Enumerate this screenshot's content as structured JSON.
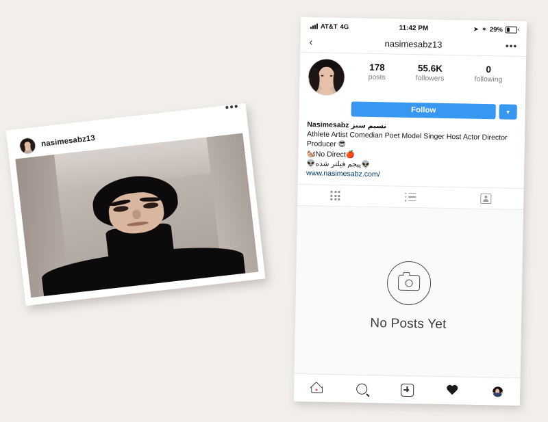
{
  "background_color": "#f2efeb",
  "accent_color": "#3897f0",
  "post_card": {
    "username": "nasimesabz13",
    "menu_icon": "more-options-icon",
    "menu_label": "•••",
    "photo_description": "Person wearing a black balaclava in front of a light wall"
  },
  "phone": {
    "status_bar": {
      "signal_icon": "cellular-signal-icon",
      "carrier": "AT&T",
      "network": "4G",
      "time": "11:42 PM",
      "location_icon": "location-arrow-icon",
      "location_glyph": "➤",
      "bluetooth_icon": "bluetooth-icon",
      "bluetooth_glyph": "✶",
      "battery_percent": "29%",
      "battery_icon": "battery-icon"
    },
    "nav_bar": {
      "back_icon": "chevron-left-icon",
      "back_glyph": "‹",
      "title": "nasimesabz13",
      "more_icon": "more-options-icon",
      "more_glyph": "•••"
    },
    "profile": {
      "avatar": "profile-avatar",
      "stats": [
        {
          "number": "178",
          "label": "posts"
        },
        {
          "number": "55.6K",
          "label": "followers"
        },
        {
          "number": "0",
          "label": "following"
        }
      ],
      "follow_label": "Follow",
      "follow_dropdown_icon": "chevron-down-icon",
      "follow_dropdown_glyph": "▼",
      "bio": {
        "name": "Nasimesabz نسیم سبز",
        "line1": "Athlete Artist Comedian Poet Model Singer Host Actor Director Producer 😎",
        "line2": "🐿️No Direct🍎",
        "line3": "👽پیجم فیلتر شده👽",
        "website": "www.nasimesabz.com/"
      }
    },
    "tabs": [
      {
        "name": "grid-tab",
        "icon": "grid-icon"
      },
      {
        "name": "list-tab",
        "icon": "list-icon"
      },
      {
        "name": "tagged-tab",
        "icon": "tagged-person-icon"
      }
    ],
    "empty_state": {
      "icon": "camera-icon",
      "text": "No Posts Yet"
    },
    "tab_bar": [
      {
        "name": "home-tab",
        "icon": "home-icon",
        "badge": true
      },
      {
        "name": "search-tab",
        "icon": "search-icon",
        "badge": false
      },
      {
        "name": "add-post-tab",
        "icon": "plus-square-icon",
        "badge": false
      },
      {
        "name": "activity-tab",
        "icon": "heart-icon",
        "badge": false
      },
      {
        "name": "profile-tab",
        "icon": "profile-avatar-icon",
        "badge": false
      }
    ]
  }
}
